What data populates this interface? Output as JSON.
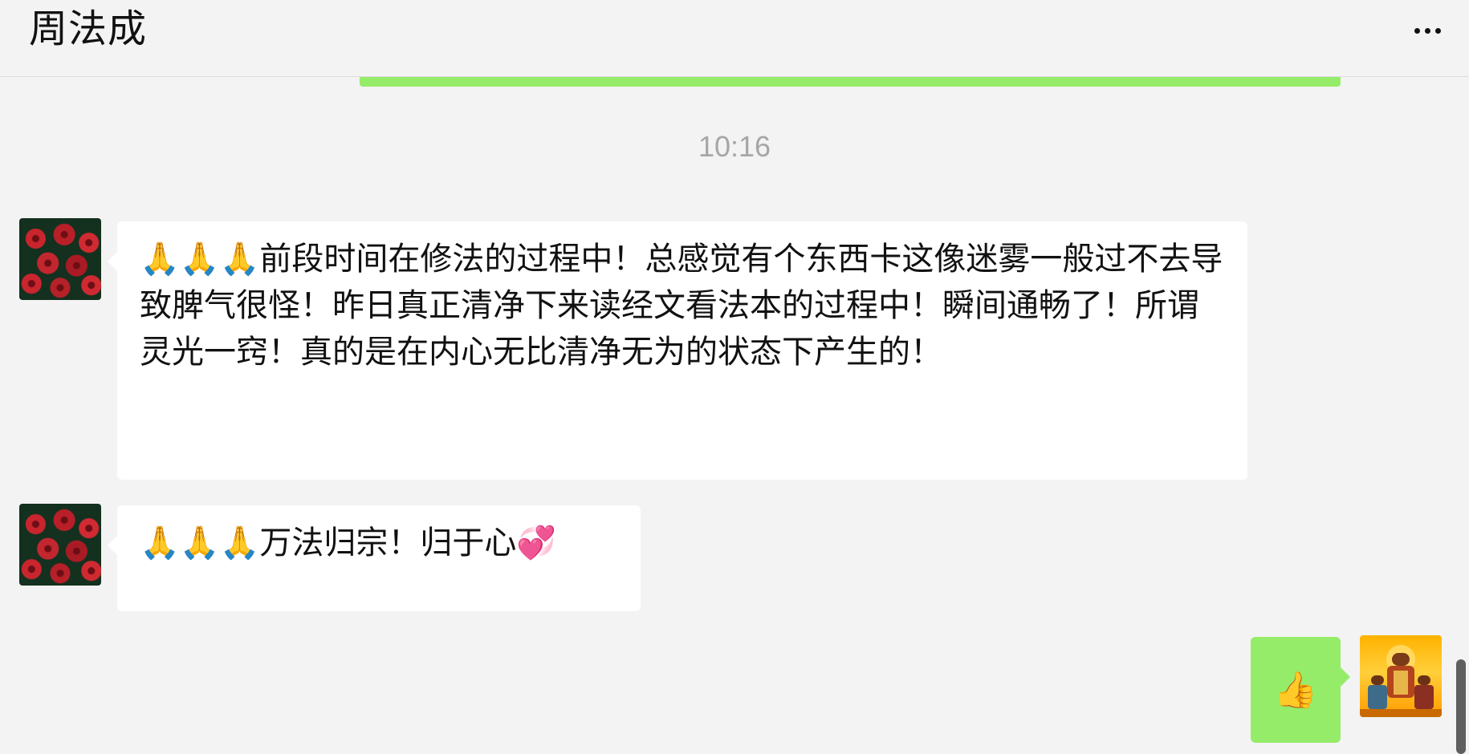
{
  "header": {
    "title": "周法成",
    "more_icon": "more-horizontal-icon"
  },
  "chat": {
    "timestamp": "10:16",
    "messages": [
      {
        "sender": "other",
        "avatar_icon": "rose-avatar",
        "text": "🙏🙏🙏前段时间在修法的过程中！总感觉有个东西卡这像迷雾一般过不去导致脾气很怪！昨日真正清净下来读经文看法本的过程中！瞬间通畅了！所谓灵光一窍！真的是在内心无比清净无为的状态下产生的！"
      },
      {
        "sender": "other",
        "avatar_icon": "rose-avatar",
        "text": "🙏🙏🙏万法归宗！归于心💞"
      },
      {
        "sender": "self",
        "avatar_icon": "deity-avatar",
        "text": "👍"
      }
    ]
  },
  "colors": {
    "background": "#f3f3f3",
    "self_bubble": "#95ec69",
    "other_bubble": "#ffffff",
    "timestamp_text": "#a6a6a6"
  }
}
